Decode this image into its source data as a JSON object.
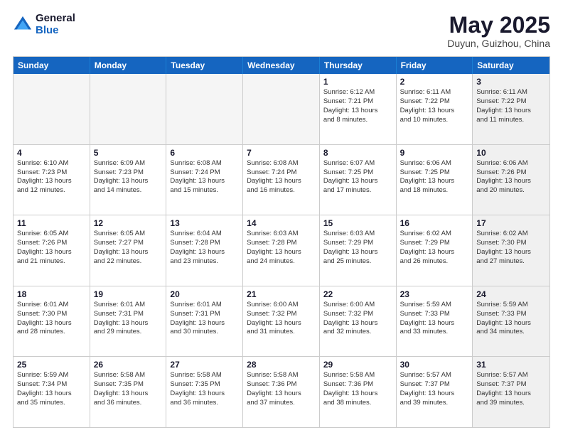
{
  "logo": {
    "general": "General",
    "blue": "Blue"
  },
  "title": {
    "month": "May 2025",
    "location": "Duyun, Guizhou, China"
  },
  "weekdays": [
    "Sunday",
    "Monday",
    "Tuesday",
    "Wednesday",
    "Thursday",
    "Friday",
    "Saturday"
  ],
  "rows": [
    [
      {
        "day": "",
        "info": "",
        "empty": true
      },
      {
        "day": "",
        "info": "",
        "empty": true
      },
      {
        "day": "",
        "info": "",
        "empty": true
      },
      {
        "day": "",
        "info": "",
        "empty": true
      },
      {
        "day": "1",
        "info": "Sunrise: 6:12 AM\nSunset: 7:21 PM\nDaylight: 13 hours\nand 8 minutes.",
        "empty": false
      },
      {
        "day": "2",
        "info": "Sunrise: 6:11 AM\nSunset: 7:22 PM\nDaylight: 13 hours\nand 10 minutes.",
        "empty": false
      },
      {
        "day": "3",
        "info": "Sunrise: 6:11 AM\nSunset: 7:22 PM\nDaylight: 13 hours\nand 11 minutes.",
        "empty": false,
        "shaded": true
      }
    ],
    [
      {
        "day": "4",
        "info": "Sunrise: 6:10 AM\nSunset: 7:23 PM\nDaylight: 13 hours\nand 12 minutes.",
        "empty": false
      },
      {
        "day": "5",
        "info": "Sunrise: 6:09 AM\nSunset: 7:23 PM\nDaylight: 13 hours\nand 14 minutes.",
        "empty": false
      },
      {
        "day": "6",
        "info": "Sunrise: 6:08 AM\nSunset: 7:24 PM\nDaylight: 13 hours\nand 15 minutes.",
        "empty": false
      },
      {
        "day": "7",
        "info": "Sunrise: 6:08 AM\nSunset: 7:24 PM\nDaylight: 13 hours\nand 16 minutes.",
        "empty": false
      },
      {
        "day": "8",
        "info": "Sunrise: 6:07 AM\nSunset: 7:25 PM\nDaylight: 13 hours\nand 17 minutes.",
        "empty": false
      },
      {
        "day": "9",
        "info": "Sunrise: 6:06 AM\nSunset: 7:25 PM\nDaylight: 13 hours\nand 18 minutes.",
        "empty": false
      },
      {
        "day": "10",
        "info": "Sunrise: 6:06 AM\nSunset: 7:26 PM\nDaylight: 13 hours\nand 20 minutes.",
        "empty": false,
        "shaded": true
      }
    ],
    [
      {
        "day": "11",
        "info": "Sunrise: 6:05 AM\nSunset: 7:26 PM\nDaylight: 13 hours\nand 21 minutes.",
        "empty": false
      },
      {
        "day": "12",
        "info": "Sunrise: 6:05 AM\nSunset: 7:27 PM\nDaylight: 13 hours\nand 22 minutes.",
        "empty": false
      },
      {
        "day": "13",
        "info": "Sunrise: 6:04 AM\nSunset: 7:28 PM\nDaylight: 13 hours\nand 23 minutes.",
        "empty": false
      },
      {
        "day": "14",
        "info": "Sunrise: 6:03 AM\nSunset: 7:28 PM\nDaylight: 13 hours\nand 24 minutes.",
        "empty": false
      },
      {
        "day": "15",
        "info": "Sunrise: 6:03 AM\nSunset: 7:29 PM\nDaylight: 13 hours\nand 25 minutes.",
        "empty": false
      },
      {
        "day": "16",
        "info": "Sunrise: 6:02 AM\nSunset: 7:29 PM\nDaylight: 13 hours\nand 26 minutes.",
        "empty": false
      },
      {
        "day": "17",
        "info": "Sunrise: 6:02 AM\nSunset: 7:30 PM\nDaylight: 13 hours\nand 27 minutes.",
        "empty": false,
        "shaded": true
      }
    ],
    [
      {
        "day": "18",
        "info": "Sunrise: 6:01 AM\nSunset: 7:30 PM\nDaylight: 13 hours\nand 28 minutes.",
        "empty": false
      },
      {
        "day": "19",
        "info": "Sunrise: 6:01 AM\nSunset: 7:31 PM\nDaylight: 13 hours\nand 29 minutes.",
        "empty": false
      },
      {
        "day": "20",
        "info": "Sunrise: 6:01 AM\nSunset: 7:31 PM\nDaylight: 13 hours\nand 30 minutes.",
        "empty": false
      },
      {
        "day": "21",
        "info": "Sunrise: 6:00 AM\nSunset: 7:32 PM\nDaylight: 13 hours\nand 31 minutes.",
        "empty": false
      },
      {
        "day": "22",
        "info": "Sunrise: 6:00 AM\nSunset: 7:32 PM\nDaylight: 13 hours\nand 32 minutes.",
        "empty": false
      },
      {
        "day": "23",
        "info": "Sunrise: 5:59 AM\nSunset: 7:33 PM\nDaylight: 13 hours\nand 33 minutes.",
        "empty": false
      },
      {
        "day": "24",
        "info": "Sunrise: 5:59 AM\nSunset: 7:33 PM\nDaylight: 13 hours\nand 34 minutes.",
        "empty": false,
        "shaded": true
      }
    ],
    [
      {
        "day": "25",
        "info": "Sunrise: 5:59 AM\nSunset: 7:34 PM\nDaylight: 13 hours\nand 35 minutes.",
        "empty": false
      },
      {
        "day": "26",
        "info": "Sunrise: 5:58 AM\nSunset: 7:35 PM\nDaylight: 13 hours\nand 36 minutes.",
        "empty": false
      },
      {
        "day": "27",
        "info": "Sunrise: 5:58 AM\nSunset: 7:35 PM\nDaylight: 13 hours\nand 36 minutes.",
        "empty": false
      },
      {
        "day": "28",
        "info": "Sunrise: 5:58 AM\nSunset: 7:36 PM\nDaylight: 13 hours\nand 37 minutes.",
        "empty": false
      },
      {
        "day": "29",
        "info": "Sunrise: 5:58 AM\nSunset: 7:36 PM\nDaylight: 13 hours\nand 38 minutes.",
        "empty": false
      },
      {
        "day": "30",
        "info": "Sunrise: 5:57 AM\nSunset: 7:37 PM\nDaylight: 13 hours\nand 39 minutes.",
        "empty": false
      },
      {
        "day": "31",
        "info": "Sunrise: 5:57 AM\nSunset: 7:37 PM\nDaylight: 13 hours\nand 39 minutes.",
        "empty": false,
        "shaded": true
      }
    ]
  ]
}
